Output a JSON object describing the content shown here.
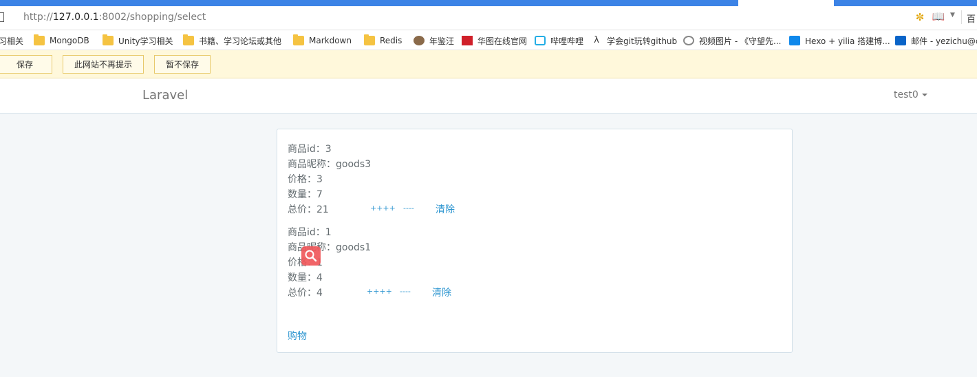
{
  "browser": {
    "address": {
      "scheme": "http://",
      "host": "127.0.0.1",
      "rest": ":8002/shopping/select"
    },
    "search_engine_label": "百"
  },
  "bookmarks": [
    {
      "label": "习相关",
      "icon": "folder-icon"
    },
    {
      "label": "MongoDB",
      "icon": "folder-icon"
    },
    {
      "label": "Unity学习相关",
      "icon": "folder-icon"
    },
    {
      "label": "书籍、学习论坛或其他",
      "icon": "folder-icon"
    },
    {
      "label": "Markdown",
      "icon": "folder-icon"
    },
    {
      "label": "Redis",
      "icon": "folder-icon"
    },
    {
      "label": "年鉴汪",
      "icon": "avatar-icon"
    },
    {
      "label": "华图在线官网",
      "icon": "huatu-logo-icon"
    },
    {
      "label": "哔哩哔哩",
      "icon": "bilibili-icon"
    },
    {
      "label": "学会git玩转github",
      "icon": "git-icon"
    },
    {
      "label": "视频图片 - 《守望先...",
      "icon": "overwatch-icon"
    },
    {
      "label": "Hexo + yilia 搭建博...",
      "icon": "zhihu-icon"
    },
    {
      "label": "邮件 - yezichu@c",
      "icon": "outlook-icon"
    }
  ],
  "password_bar": {
    "save_label": "保存",
    "never_label": "此网站不再提示",
    "not_now_label": "暂不保存"
  },
  "navbar": {
    "brand": "Laravel",
    "user": "test0"
  },
  "cart": {
    "items": [
      {
        "id_line": "商品id：3",
        "name_line": "商品昵称：goods3",
        "price_line": "价格：3",
        "qty_line": "数量：7",
        "total_line": "总价：21",
        "plus_label": "++++",
        "minus_label": "----",
        "clear_label": "清除"
      },
      {
        "id_line": "商品id：1",
        "name_line": "商品昵称：goods1",
        "price_line": "价格：1",
        "qty_line": "数量：4",
        "total_line": "总价：4",
        "plus_label": "++++",
        "minus_label": "----",
        "clear_label": "清除"
      }
    ],
    "buy_label": "购物"
  },
  "colors": {
    "tab_strip": "#3c83e6",
    "link": "#3097d1",
    "text": "#636b6f",
    "overlay_search": "#f0585c"
  }
}
